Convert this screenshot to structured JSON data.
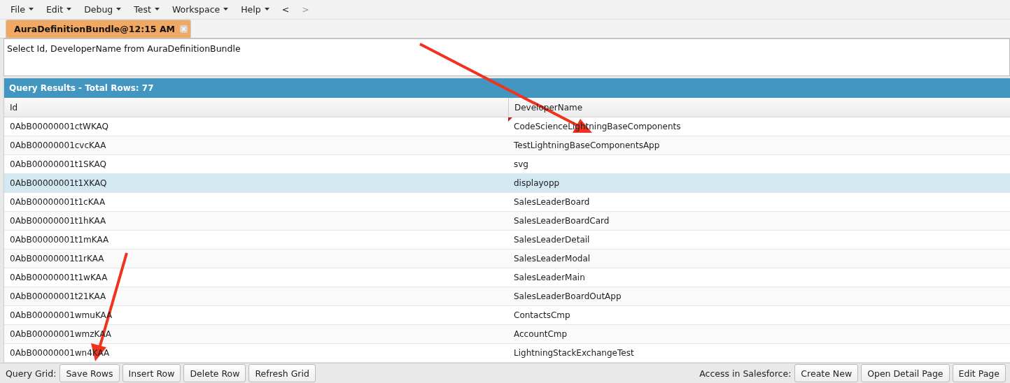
{
  "menu": [
    {
      "label": "File",
      "dropdown": true
    },
    {
      "label": "Edit",
      "dropdown": true
    },
    {
      "label": "Debug",
      "dropdown": true
    },
    {
      "label": "Test",
      "dropdown": true
    },
    {
      "label": "Workspace",
      "dropdown": true
    },
    {
      "label": "Help",
      "dropdown": true
    },
    {
      "label": "<",
      "dropdown": false,
      "disabled": false
    },
    {
      "label": ">",
      "dropdown": false,
      "disabled": true
    }
  ],
  "tabs": [
    {
      "label": "AuraDefinitionBundle@12:15 AM",
      "selected": true
    }
  ],
  "query": {
    "value": "Select Id, DeveloperName from AuraDefinitionBundle"
  },
  "results": {
    "title": "Query Results - Total Rows: 77",
    "columns": [
      "Id",
      "DeveloperName"
    ],
    "rows": [
      {
        "cells": [
          "0AbB00000001ctWKAQ",
          "CodeScienceLightningBaseComponents"
        ],
        "selected": false,
        "edited": true
      },
      {
        "cells": [
          "0AbB00000001cvcKAA",
          "TestLightningBaseComponentsApp"
        ],
        "selected": false,
        "edited": false
      },
      {
        "cells": [
          "0AbB00000001t1SKAQ",
          "svg"
        ],
        "selected": false,
        "edited": false
      },
      {
        "cells": [
          "0AbB00000001t1XKAQ",
          "displayopp"
        ],
        "selected": true,
        "edited": false
      },
      {
        "cells": [
          "0AbB00000001t1cKAA",
          "SalesLeaderBoard"
        ],
        "selected": false,
        "edited": false
      },
      {
        "cells": [
          "0AbB00000001t1hKAA",
          "SalesLeaderBoardCard"
        ],
        "selected": false,
        "edited": false
      },
      {
        "cells": [
          "0AbB00000001t1mKAA",
          "SalesLeaderDetail"
        ],
        "selected": false,
        "edited": false
      },
      {
        "cells": [
          "0AbB00000001t1rKAA",
          "SalesLeaderModal"
        ],
        "selected": false,
        "edited": false
      },
      {
        "cells": [
          "0AbB00000001t1wKAA",
          "SalesLeaderMain"
        ],
        "selected": false,
        "edited": false
      },
      {
        "cells": [
          "0AbB00000001t21KAA",
          "SalesLeaderBoardOutApp"
        ],
        "selected": false,
        "edited": false
      },
      {
        "cells": [
          "0AbB00000001wmuKAA",
          "ContactsCmp"
        ],
        "selected": false,
        "edited": false
      },
      {
        "cells": [
          "0AbB00000001wmzKAA",
          "AccountCmp"
        ],
        "selected": false,
        "edited": false
      },
      {
        "cells": [
          "0AbB00000001wn4KAA",
          "LightningStackExchangeTest"
        ],
        "selected": false,
        "edited": false
      }
    ]
  },
  "footer": {
    "left_label": "Query Grid:",
    "left_buttons": [
      "Save Rows",
      "Insert Row",
      "Delete Row",
      "Refresh Grid"
    ],
    "right_label": "Access in Salesforce:",
    "right_buttons": [
      "Create New",
      "Open Detail Page",
      "Edit Page"
    ]
  }
}
